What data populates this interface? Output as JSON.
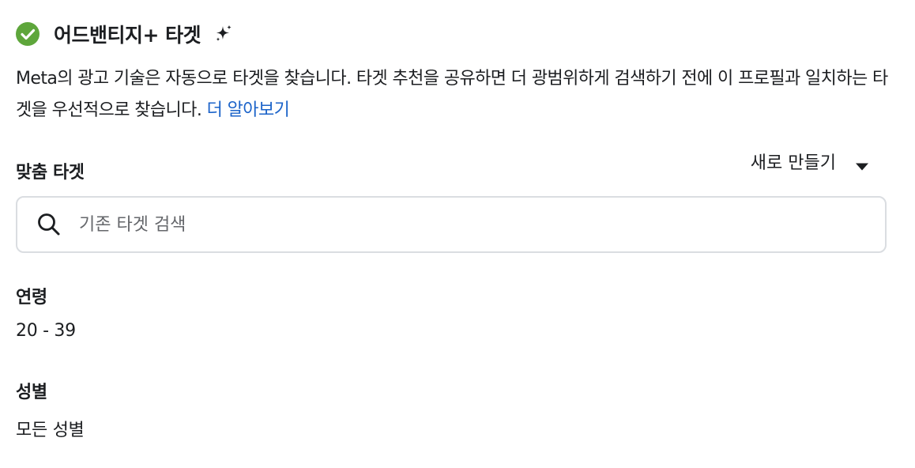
{
  "header": {
    "title": "어드밴티지+ 타겟",
    "status_icon": "check-circle-icon",
    "status_color": "#5ea63b",
    "ai_icon": "sparkle-icon"
  },
  "description": {
    "text": "Meta의 광고 기술은 자동으로 타겟을 찾습니다. 타겟 추천을 공유하면 더 광범위하게 검색하기 전에 이 프로필과 일치하는 타겟을 우선적으로 찾습니다. ",
    "link_label": "더 알아보기",
    "link_color": "#1b63c9"
  },
  "custom_audience": {
    "label": "맞춤 타겟",
    "create_new_label": "새로 만들기",
    "dropdown_icon": "caret-down-icon",
    "search_placeholder": "기존 타겟 검색",
    "search_value": "",
    "search_icon": "search-icon"
  },
  "age": {
    "label": "연령",
    "value": "20 - 39"
  },
  "gender": {
    "label": "성별",
    "value": "모든 성별"
  }
}
